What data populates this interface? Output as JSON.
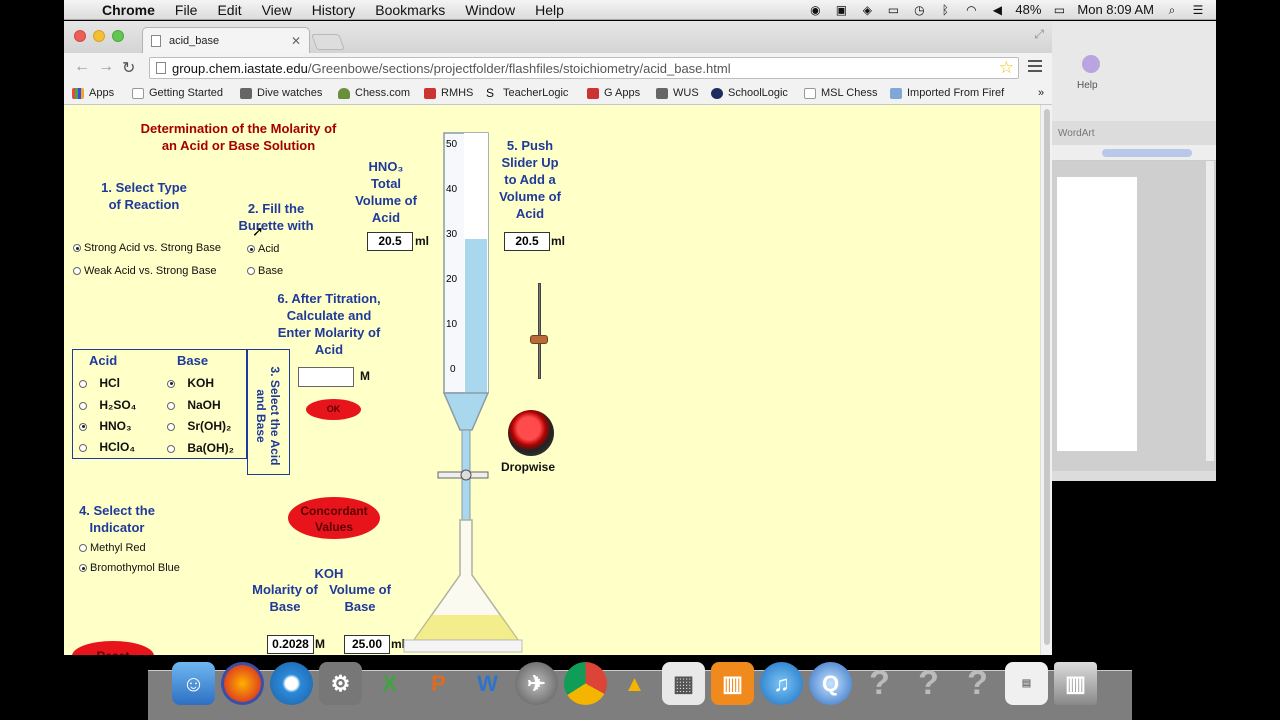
{
  "menubar": {
    "app_name": "Chrome",
    "menus": [
      "File",
      "Edit",
      "View",
      "History",
      "Bookmarks",
      "Window",
      "Help"
    ],
    "battery": "48%",
    "clock": "Mon 8:09 AM"
  },
  "browser": {
    "tab_title": "acid_base",
    "url_host": "group.chem.iastate.edu",
    "url_path": "/Greenbowe/sections/projectfolder/flashfiles/stoichiometry/acid_base.html",
    "bookmarks": [
      "Apps",
      "Getting Started",
      "Dive watches",
      "Chess.com",
      "RMHS",
      "TeacherLogic",
      "G Apps",
      "WUS",
      "SchoolLogic",
      "MSL Chess",
      "Imported From Firef"
    ],
    "bookmarks_more": "»"
  },
  "sim": {
    "title_line1": "Determination of the Molarity of",
    "title_line2": "an Acid or Base Solution",
    "step1_line1": "1. Select Type",
    "step1_line2": "of Reaction",
    "reaction_options": [
      "Strong Acid vs. Strong Base",
      "Weak Acid vs. Strong Base"
    ],
    "step2_line1": "2. Fill the",
    "step2_line2": "Burette with",
    "fill_options": [
      "Acid",
      "Base"
    ],
    "acid_label": "HNO₃",
    "total_vol_line1": "Total",
    "total_vol_line2": "Volume of",
    "total_vol_line3": "Acid",
    "total_volume": "20.5",
    "ml": "ml",
    "step5_line1": "5. Push",
    "step5_line2": "Slider Up",
    "step5_line3": "to Add a",
    "step5_line4": "Volume of",
    "step5_line5": "Acid",
    "added_volume": "20.5",
    "step6_line1": "6. After Titration,",
    "step6_line2": "Calculate and",
    "step6_line3": "Enter Molarity of",
    "step6_line4": "Acid",
    "molarity_input": "",
    "m_unit": "M",
    "ok_label": "OK",
    "acid_header": "Acid",
    "base_header": "Base",
    "acids": [
      "HCl",
      "H₂SO₄",
      "HNO₃",
      "HClO₄"
    ],
    "bases": [
      "KOH",
      "NaOH",
      "Sr(OH)₂",
      "Ba(OH)₂"
    ],
    "step3_line1": "3. Select the Acid",
    "step3_line2": "and Base",
    "dropwise_label": "Dropwise",
    "step4_line1": "4. Select the",
    "step4_line2": "Indicator",
    "indicators": [
      "Methyl Red",
      "Bromothymol Blue"
    ],
    "concordant_line1": "Concordant",
    "concordant_line2": "Values",
    "base_name": "KOH",
    "base_molarity_label_1": "Molarity of",
    "base_molarity_label_2": "Base",
    "base_volume_label_1": "Volume of",
    "base_volume_label_2": "Base",
    "base_molarity": "0.2028",
    "base_volume": "25.00",
    "reset_label": "Reset",
    "burette_ticks": [
      "50",
      "40",
      "30",
      "20",
      "10",
      "0"
    ]
  },
  "rightapp": {
    "help_label": "Help",
    "wordart_label": "WordArt"
  },
  "colors": {
    "page_bg": "#ffffc8",
    "heading_blue": "#1f3a9a",
    "title_red": "#a40000",
    "button_red": "#e8141c"
  }
}
